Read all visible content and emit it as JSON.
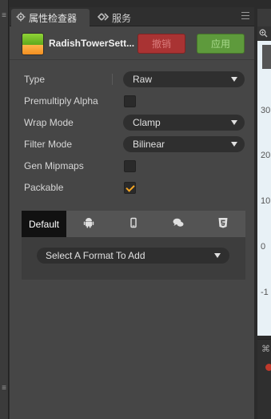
{
  "tabs": {
    "inspector_label": "属性检查器",
    "services_label": "服务"
  },
  "asset": {
    "name": "RadishTowerSett...",
    "revert_label": "撤销",
    "apply_label": "应用"
  },
  "properties": {
    "type": {
      "label": "Type",
      "value": "Raw"
    },
    "premultiply_alpha": {
      "label": "Premultiply Alpha",
      "checked": false
    },
    "wrap_mode": {
      "label": "Wrap Mode",
      "value": "Clamp"
    },
    "filter_mode": {
      "label": "Filter Mode",
      "value": "Bilinear"
    },
    "gen_mipmaps": {
      "label": "Gen Mipmaps",
      "checked": false
    },
    "packable": {
      "label": "Packable",
      "checked": true
    }
  },
  "platforms": {
    "tabs": [
      {
        "label": "Default",
        "icon": "default"
      },
      {
        "label": "",
        "icon": "android-icon"
      },
      {
        "label": "",
        "icon": "mobile-icon"
      },
      {
        "label": "",
        "icon": "chat-bubbles-icon"
      },
      {
        "label": "",
        "icon": "html5-icon"
      }
    ],
    "format_placeholder": "Select A Format To Add"
  },
  "right_panel": {
    "y_labels": [
      "30",
      "20",
      "10",
      "0",
      "-1"
    ]
  },
  "colors": {
    "revert_bg": "#a93333",
    "apply_bg": "#5e9a3c",
    "check_accent": "#f5a623"
  }
}
